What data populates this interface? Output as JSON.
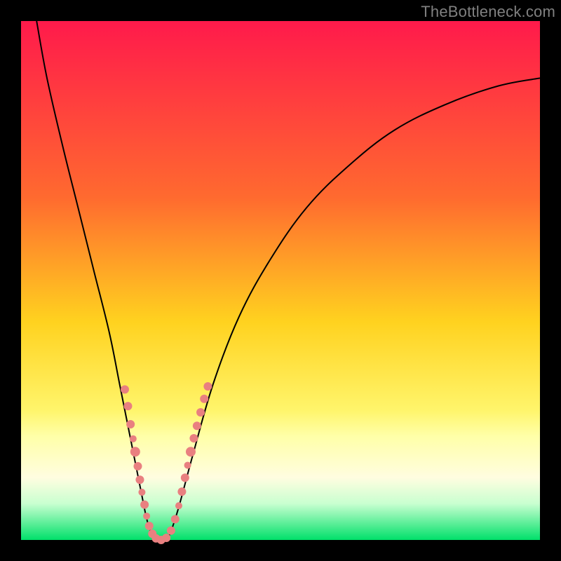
{
  "watermark": "TheBottleneck.com",
  "chart_data": {
    "type": "line",
    "title": "",
    "xlabel": "",
    "ylabel": "",
    "xlim": [
      0,
      100
    ],
    "ylim": [
      0,
      100
    ],
    "gradient_stops": [
      {
        "offset": 0,
        "color": "#ff1a4b"
      },
      {
        "offset": 34,
        "color": "#ff6a2f"
      },
      {
        "offset": 58,
        "color": "#ffd21f"
      },
      {
        "offset": 75,
        "color": "#fff56b"
      },
      {
        "offset": 80,
        "color": "#ffffa8"
      },
      {
        "offset": 88,
        "color": "#fffde0"
      },
      {
        "offset": 93,
        "color": "#c9ffd0"
      },
      {
        "offset": 100,
        "color": "#00e06a"
      }
    ],
    "series": [
      {
        "name": "bottleneck-curve",
        "color": "#000000",
        "width": 2,
        "x": [
          3,
          5,
          8,
          11,
          14,
          17,
          19,
          21,
          23,
          24.5,
          26,
          28,
          30,
          33,
          37,
          42,
          48,
          55,
          63,
          72,
          82,
          92,
          100
        ],
        "y": [
          100,
          89,
          76,
          64,
          52,
          40,
          30,
          20,
          10,
          3,
          0,
          0,
          5,
          16,
          30,
          43,
          54,
          64,
          72,
          79,
          84,
          87.5,
          89
        ]
      }
    ],
    "markers": {
      "name": "dense-points",
      "color": "#e98080",
      "radius_min": 4,
      "radius_max": 8,
      "points": [
        {
          "x": 20.0,
          "y": 29.0,
          "r": 6
        },
        {
          "x": 20.6,
          "y": 25.8,
          "r": 6
        },
        {
          "x": 21.1,
          "y": 22.3,
          "r": 6
        },
        {
          "x": 21.6,
          "y": 19.5,
          "r": 5
        },
        {
          "x": 22.0,
          "y": 17.0,
          "r": 7
        },
        {
          "x": 22.5,
          "y": 14.2,
          "r": 6
        },
        {
          "x": 22.9,
          "y": 11.6,
          "r": 6
        },
        {
          "x": 23.3,
          "y": 9.2,
          "r": 5
        },
        {
          "x": 23.8,
          "y": 6.8,
          "r": 6
        },
        {
          "x": 24.2,
          "y": 4.6,
          "r": 5
        },
        {
          "x": 24.7,
          "y": 2.7,
          "r": 6
        },
        {
          "x": 25.3,
          "y": 1.2,
          "r": 6
        },
        {
          "x": 26.0,
          "y": 0.3,
          "r": 6
        },
        {
          "x": 27.0,
          "y": 0.0,
          "r": 6
        },
        {
          "x": 28.0,
          "y": 0.4,
          "r": 6
        },
        {
          "x": 28.9,
          "y": 1.8,
          "r": 6
        },
        {
          "x": 29.7,
          "y": 4.0,
          "r": 6
        },
        {
          "x": 30.4,
          "y": 6.6,
          "r": 5
        },
        {
          "x": 31.0,
          "y": 9.3,
          "r": 6
        },
        {
          "x": 31.6,
          "y": 12.0,
          "r": 6
        },
        {
          "x": 32.1,
          "y": 14.4,
          "r": 5
        },
        {
          "x": 32.7,
          "y": 17.0,
          "r": 7
        },
        {
          "x": 33.3,
          "y": 19.6,
          "r": 6
        },
        {
          "x": 33.9,
          "y": 22.0,
          "r": 6
        },
        {
          "x": 34.6,
          "y": 24.6,
          "r": 6
        },
        {
          "x": 35.3,
          "y": 27.2,
          "r": 6
        },
        {
          "x": 36.0,
          "y": 29.6,
          "r": 6
        }
      ]
    }
  }
}
